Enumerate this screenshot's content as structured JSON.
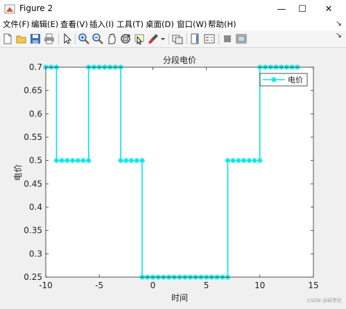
{
  "window": {
    "title": "Figure 2",
    "minimize_glyph": "—",
    "maximize_glyph": "☐",
    "close_glyph": "✕"
  },
  "menu": {
    "items": [
      "文件(F)",
      "编辑(E)",
      "查看(V)",
      "插入(I)",
      "工具(T)",
      "桌面(D)",
      "窗口(W)",
      "帮助(H)"
    ],
    "right_glyph": "↘"
  },
  "toolbar": {
    "icons": [
      "new-figure-icon",
      "open-file-icon",
      "save-icon",
      "print-icon",
      "pointer-icon",
      "zoom-in-icon",
      "zoom-out-icon",
      "pan-icon",
      "rotate-3d-icon",
      "data-cursor-icon",
      "brush-icon",
      "dropdown-arrow-icon",
      "link-plot-icon",
      "colorbar-icon",
      "legend-icon",
      "hide-plot-tools-icon",
      "show-plot-tools-icon"
    ],
    "right_glyph": "↘"
  },
  "chart_data": {
    "type": "line",
    "title": "分段电价",
    "xlabel": "时间",
    "ylabel": "电价",
    "xlim": [
      -10,
      15
    ],
    "ylim": [
      0.25,
      0.7
    ],
    "xticks": [
      -10,
      -5,
      0,
      5,
      10,
      15
    ],
    "yticks": [
      0.25,
      0.3,
      0.35,
      0.4,
      0.45,
      0.5,
      0.55,
      0.6,
      0.65,
      0.7
    ],
    "xtick_labels": [
      "-10",
      "-5",
      "0",
      "5",
      "10",
      "15"
    ],
    "ytick_labels": [
      "0.25",
      "0.3",
      "0.35",
      "0.4",
      "0.45",
      "0.5",
      "0.55",
      "0.6",
      "0.65",
      "0.7"
    ],
    "grid": false,
    "legend_position": "top-right",
    "color": "#00e5e5",
    "marker": "*",
    "series": [
      {
        "name": "电价",
        "segments": [
          {
            "x0": -10,
            "x1": -9,
            "y": 0.7
          },
          {
            "x0": -9,
            "x1": -6,
            "y": 0.5
          },
          {
            "x0": -6,
            "x1": -3,
            "y": 0.7
          },
          {
            "x0": -3,
            "x1": -1,
            "y": 0.5
          },
          {
            "x0": -1,
            "x1": 7,
            "y": 0.25
          },
          {
            "x0": 7,
            "x1": 10,
            "y": 0.5
          },
          {
            "x0": 10,
            "x1": 13.5,
            "y": 0.7
          }
        ],
        "marker_spacing": 0.5
      }
    ]
  },
  "watermark": "CSDN @研学社"
}
